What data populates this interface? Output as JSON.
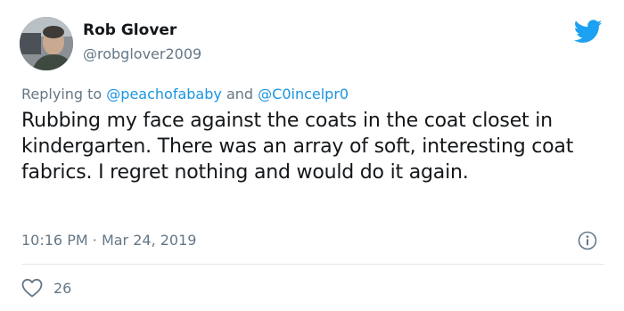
{
  "author": {
    "name": "Rob Glover",
    "handle": "@robglover2009",
    "avatar_icon": "profile-photo"
  },
  "brand": {
    "icon": "twitter-bird-icon",
    "color": "#1da1f2"
  },
  "reply": {
    "prefix": "Replying to",
    "mention1": "@peachofababy",
    "joiner": "and",
    "mention2": "@C0incelpr0",
    "mention_color": "#1b95e0"
  },
  "tweet": {
    "text": "Rubbing my face against the coats in the coat closet in kindergarten. There was an array of soft, interesting coat fabrics. I regret nothing and would do it again."
  },
  "meta": {
    "time": "10:16 PM",
    "separator": "·",
    "date": "Mar 24, 2019",
    "info_icon": "info-icon"
  },
  "engagement": {
    "likes_icon": "heart-icon",
    "likes": "26"
  }
}
